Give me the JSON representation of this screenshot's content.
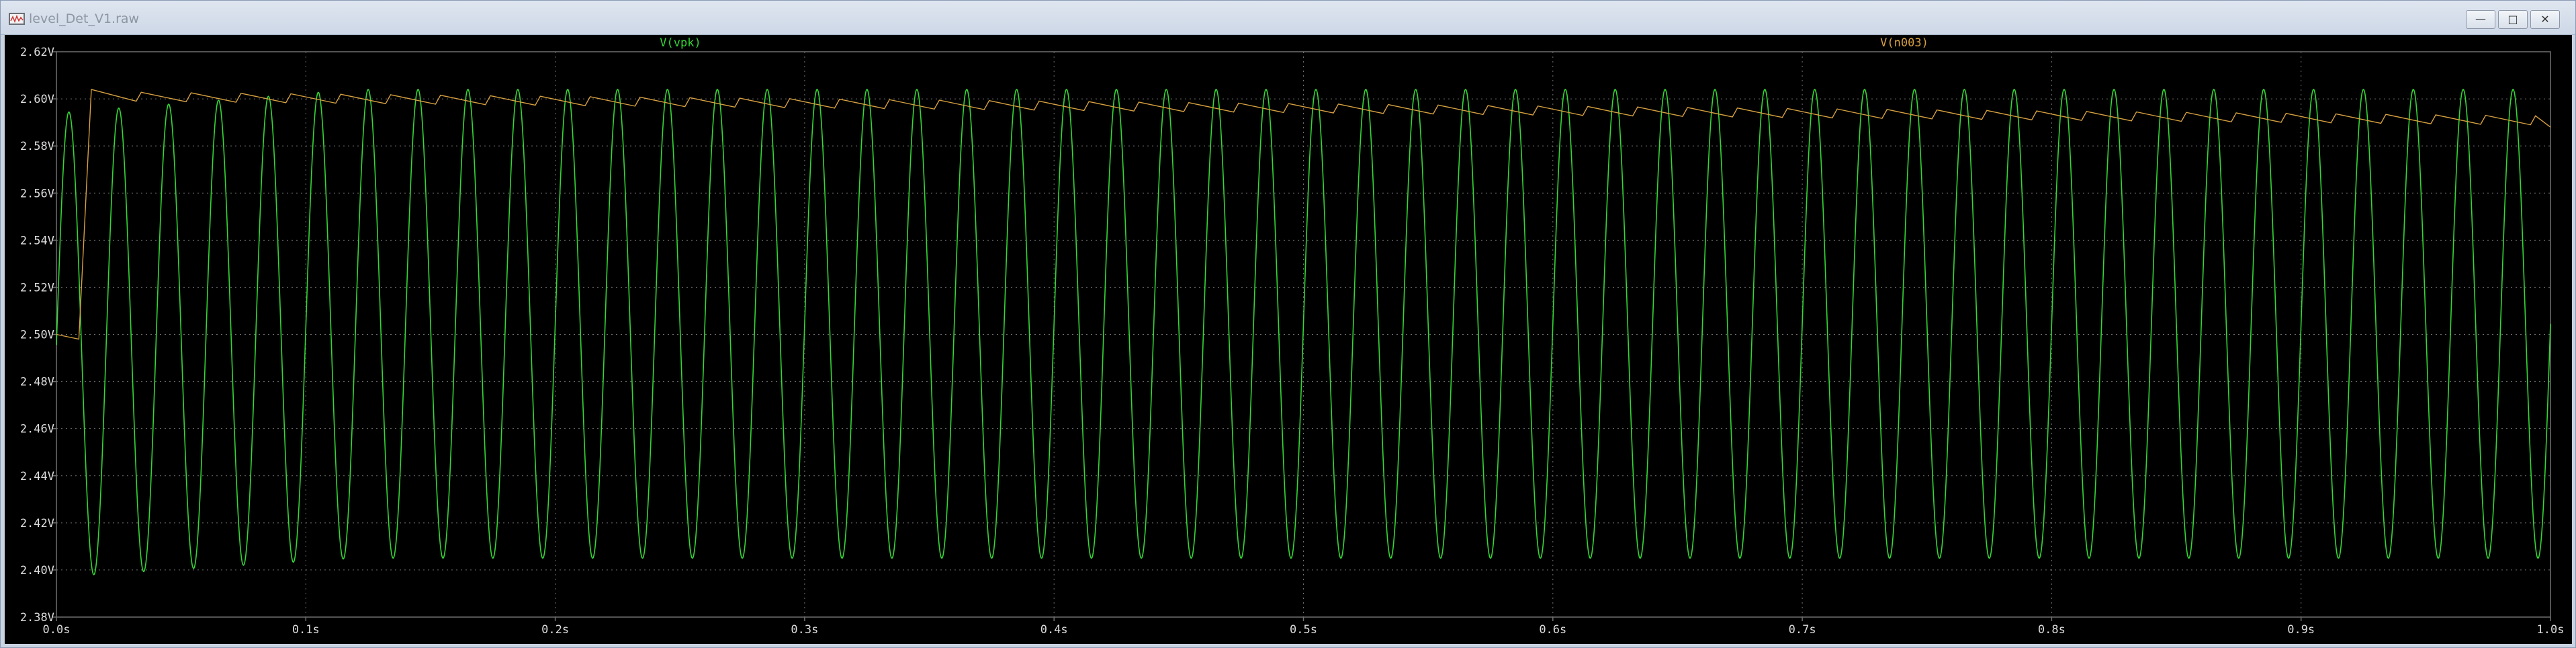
{
  "window": {
    "title": "level_Det_V1.raw",
    "buttons": {
      "minimize": "—",
      "maximize": "□",
      "close": "✕"
    },
    "icon": "waveform-viewer-icon"
  },
  "colors": {
    "background": "#000000",
    "grid": "#707070",
    "axis_text": "#dcdcdc",
    "vpk": "#33d633",
    "n003": "#d6a040"
  },
  "chart_data": {
    "type": "line",
    "xlabel": "",
    "ylabel": "",
    "xlim": [
      0.0,
      1.0
    ],
    "ylim": [
      2.38,
      2.62
    ],
    "grid": true,
    "x_ticks": [
      0.0,
      0.1,
      0.2,
      0.3,
      0.4,
      0.5,
      0.6,
      0.7,
      0.8,
      0.9,
      1.0
    ],
    "x_tick_labels": [
      "0.0s",
      "0.1s",
      "0.2s",
      "0.3s",
      "0.4s",
      "0.5s",
      "0.6s",
      "0.7s",
      "0.8s",
      "0.9s",
      "1.0s"
    ],
    "y_ticks": [
      2.38,
      2.4,
      2.42,
      2.44,
      2.46,
      2.48,
      2.5,
      2.52,
      2.54,
      2.56,
      2.58,
      2.6,
      2.62
    ],
    "y_tick_labels": [
      "2.38V",
      "2.40V",
      "2.42V",
      "2.44V",
      "2.46V",
      "2.48V",
      "2.50V",
      "2.52V",
      "2.54V",
      "2.56V",
      "2.58V",
      "2.60V",
      "2.62V"
    ],
    "series": [
      {
        "name": "V(vpk)",
        "color": "#33d633",
        "kind": "sine",
        "frequency_hz": 50,
        "start_x": 0.0,
        "end_x": 1.0,
        "offset": 2.5,
        "peaks_start": [
          2.594,
          2.603
        ],
        "trough_start": 2.397,
        "peak_steady": 2.604,
        "trough_steady": 2.405,
        "end_value": 2.508
      },
      {
        "name": "V(n003)",
        "color": "#d6a040",
        "kind": "sawtooth",
        "initial_points": [
          [
            0.0,
            2.5
          ],
          [
            0.009,
            2.498
          ],
          [
            0.014,
            2.604
          ]
        ],
        "period": 0.02,
        "peak_start": 2.603,
        "peak_end": 2.593,
        "drop": 0.004,
        "end_value": 2.588
      }
    ]
  }
}
